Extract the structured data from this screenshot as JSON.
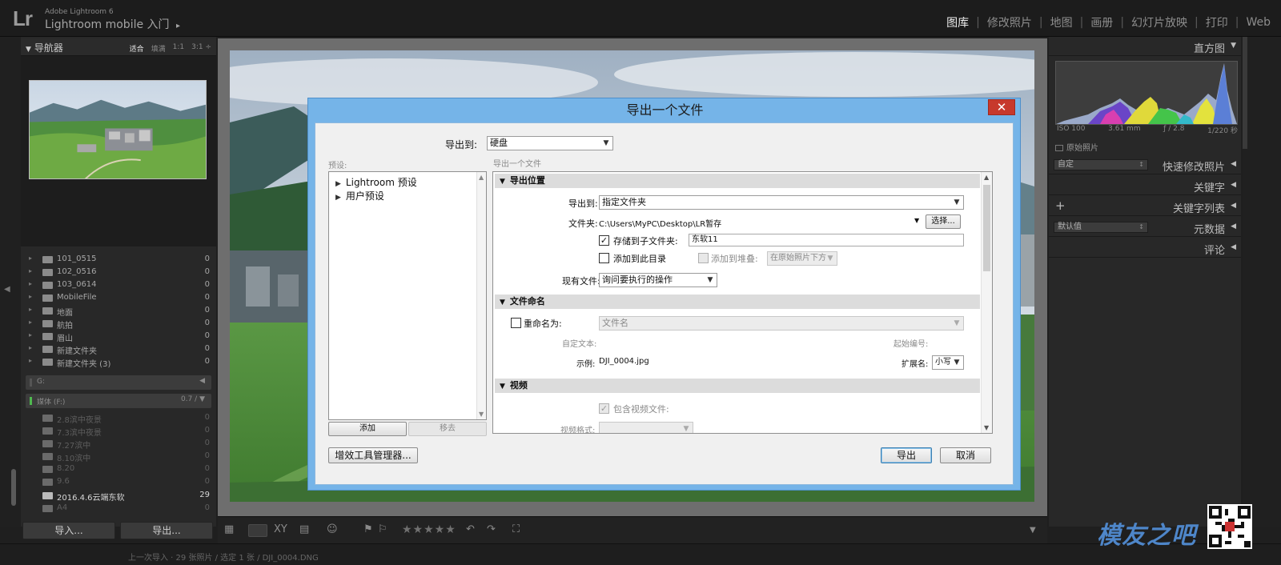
{
  "app": {
    "logo": "Lr",
    "version_label": "Adobe Lightroom 6",
    "mobile_label": "Lightroom mobile 入门",
    "mobile_arrow": "▸"
  },
  "modules": [
    {
      "label": "图库",
      "active": true
    },
    {
      "label": "修改照片",
      "active": false
    },
    {
      "label": "地图",
      "active": false
    },
    {
      "label": "画册",
      "active": false
    },
    {
      "label": "幻灯片放映",
      "active": false
    },
    {
      "label": "打印",
      "active": false
    },
    {
      "label": "Web",
      "active": false
    }
  ],
  "module_separator": "|",
  "navigator": {
    "title": "导航器",
    "zoom_options": [
      "适合",
      "填满",
      "1:1",
      "3:1 ÷"
    ]
  },
  "folders": [
    {
      "name": "101_0515",
      "count": "0"
    },
    {
      "name": "102_0516",
      "count": "0"
    },
    {
      "name": "103_0614",
      "count": "0"
    },
    {
      "name": "MobileFile",
      "count": "0"
    },
    {
      "name": "地面",
      "count": "0"
    },
    {
      "name": "航拍",
      "count": "0"
    },
    {
      "name": "眉山",
      "count": "0"
    },
    {
      "name": "新建文件夹",
      "count": "0"
    },
    {
      "name": "新建文件夹 (3)",
      "count": "0"
    }
  ],
  "drives": [
    {
      "name": "G:",
      "right": "◀"
    },
    {
      "name": "媒体 (F:)",
      "right": "0.7 / ▼"
    }
  ],
  "folders2": [
    {
      "name": "2.8滨中夜景",
      "count": "0"
    },
    {
      "name": "7.3滨中夜景",
      "count": "0"
    },
    {
      "name": "7.27滨中",
      "count": "0"
    },
    {
      "name": "8.10滨中",
      "count": "0"
    },
    {
      "name": "8.20",
      "count": "0"
    },
    {
      "name": "9.6",
      "count": "0"
    },
    {
      "name": "2016.4.6云端东软",
      "count": "29"
    },
    {
      "name": "A4",
      "count": "0"
    }
  ],
  "left_buttons": {
    "import": "导入...",
    "export": "导出..."
  },
  "right_panel": {
    "histogram_title": "直方图",
    "meta": [
      "ISO 100",
      "3.61 mm",
      "ƒ / 2.8",
      "1/220 秒"
    ],
    "original_photo": "原始照片",
    "quick_develop": {
      "select": "自定",
      "title": "快速修改照片"
    },
    "keywords_title": "关键字",
    "keyword_list_title": "关键字列表",
    "metadata": {
      "select": "默认值",
      "title": "元数据"
    },
    "comments_title": "评论"
  },
  "filmstrip": {
    "stars": "★★★★★"
  },
  "bottom_path": "上一次导入 · 29 张照片 / 选定 1 张 / DJI_0004.DNG",
  "watermark": "模友之吧",
  "dialog": {
    "title": "导出一个文件",
    "close": "✕",
    "export_to_label": "导出到:",
    "export_to_value": "硬盘",
    "presets_label": "预设:",
    "subtitle": "导出一个文件",
    "presets": [
      "Lightroom 预设",
      "用户预设"
    ],
    "add_button": "添加",
    "remove_button": "移去",
    "plugin_manager_button": "增效工具管理器...",
    "export_button": "导出",
    "cancel_button": "取消",
    "location": {
      "section": "导出位置",
      "export_to_label": "导出到:",
      "export_to_value": "指定文件夹",
      "folder_label": "文件夹:",
      "folder_value": "C:\\Users\\MyPC\\Desktop\\LR暂存",
      "choose_button": "选择...",
      "subfolder_label": "存储到子文件夹:",
      "subfolder_value": "东软11",
      "subfolder_checked": true,
      "add_to_catalog": "添加到此目录",
      "add_to_stack": "添加到堆叠:",
      "stack_position": "在原始照片下方",
      "existing_label": "现有文件:",
      "existing_value": "询问要执行的操作"
    },
    "naming": {
      "section": "文件命名",
      "rename_label": "重命名为:",
      "rename_value": "文件名",
      "custom_text": "自定文本:",
      "start_number": "起始编号:",
      "example_label": "示例:",
      "example_value": "DJI_0004.jpg",
      "extension_label": "扩展名:",
      "extension_value": "小写"
    },
    "video": {
      "section": "视频",
      "include_video": "包含视频文件:",
      "video_format": "视频格式:"
    }
  }
}
